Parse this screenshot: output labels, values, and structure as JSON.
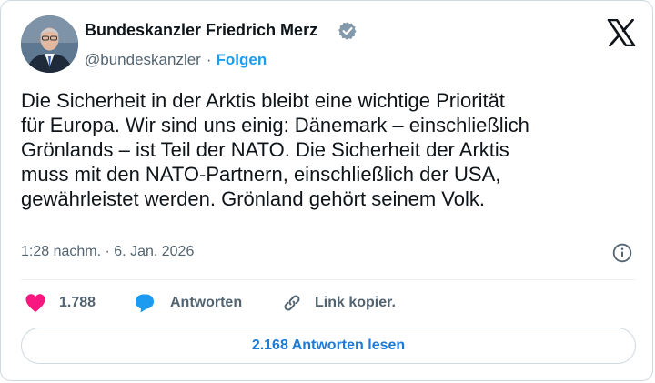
{
  "author": {
    "name": "Bundeskanzler Friedrich Merz",
    "handle": "@bundeskanzler",
    "separator": "·",
    "follow_label": "Folgen",
    "avatar_icon": "portrait-photo",
    "verified_icon": "gray-verified-badge-icon"
  },
  "platform_logo": "x-logo-icon",
  "tweet": {
    "text": "Die Sicherheit in der Arktis bleibt eine wichtige Priorität\nfür Europa. Wir sind uns einig: Dänemark – einschließlich\nGrönlands – ist Teil der NATO. Die Sicherheit der Arktis\nmuss mit den NATO-Partnern, einschließlich der USA,\ngewährleistet werden. Grönland gehört seinem Volk.",
    "timestamp": "1:28 nachm. · 6. Jan. 2026"
  },
  "actions": {
    "like_count": "1.788",
    "reply_label": "Antworten",
    "copy_link_label": "Link kopier."
  },
  "read_replies_label": "2.168 Antworten lesen",
  "colors": {
    "accent": "#1d9bf0",
    "like": "#f91880",
    "text": "#0f1419",
    "muted": "#536471",
    "border": "#cfd9de"
  }
}
